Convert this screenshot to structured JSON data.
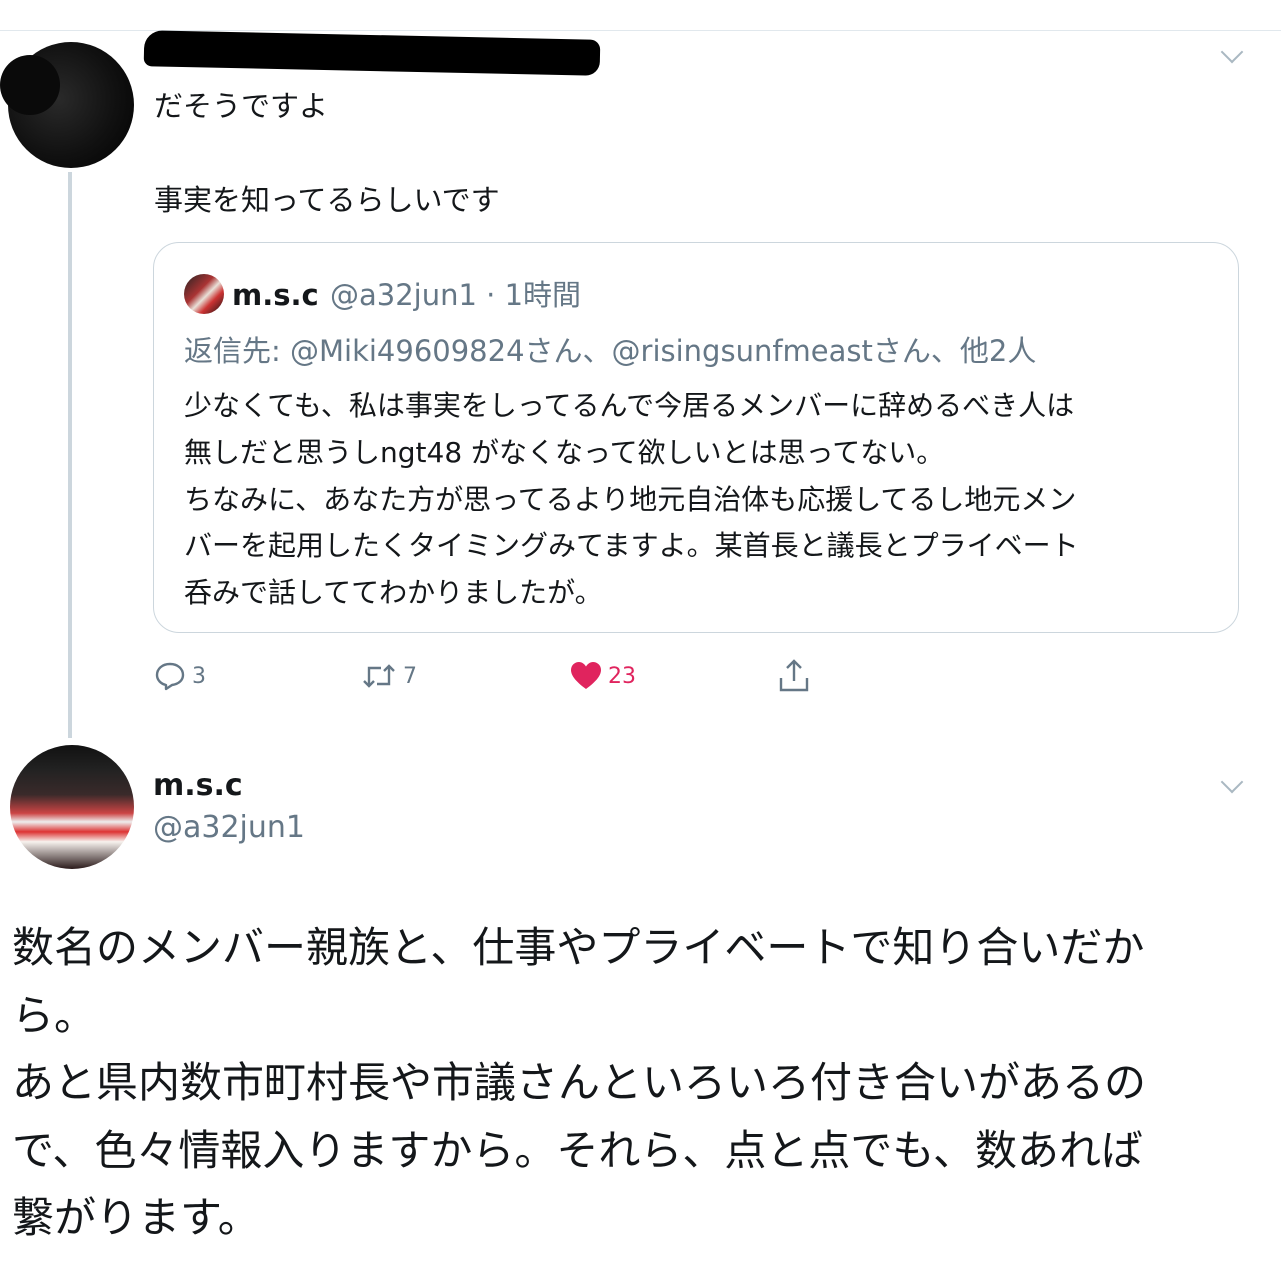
{
  "first_tweet": {
    "line1": "だそうですよ",
    "line2": "事実を知ってるらしいです"
  },
  "quoted_tweet": {
    "name": "m.s.c",
    "handle_time": "@a32jun1 · 1時間",
    "reply_to": "返信先: @Miki49609824さん、@risingsunfmeastさん、他2人",
    "body": [
      "少なくても、私は事実をしってるんで今居るメンバーに辞めるべき人は",
      "無しだと思うしngt48 がなくなって欲しいとは思ってない。",
      "ちなみに、あなた方が思ってるより地元自治体も応援してるし地元メン",
      "バーを起用したくタイミングみてますよ。某首長と議長とプライベート",
      "呑みで話しててわかりましたが。"
    ]
  },
  "actions": {
    "reply_count": "3",
    "retweet_count": "7",
    "like_count": "23",
    "like_color": "#e0245e"
  },
  "main_tweet": {
    "name": "m.s.c",
    "handle": "@a32jun1",
    "body": [
      "数名のメンバー親族と、仕事やプライベートで知り合いだか",
      "ら。",
      "あと県内数市町村長や市議さんといろいろ付き合いがあるの",
      "で、色々情報入りますから。それら、点と点でも、数あれば",
      "繋がります。"
    ]
  },
  "icons": [
    "reply-icon",
    "retweet-icon",
    "like-icon",
    "share-icon",
    "chevron-down-icon"
  ]
}
